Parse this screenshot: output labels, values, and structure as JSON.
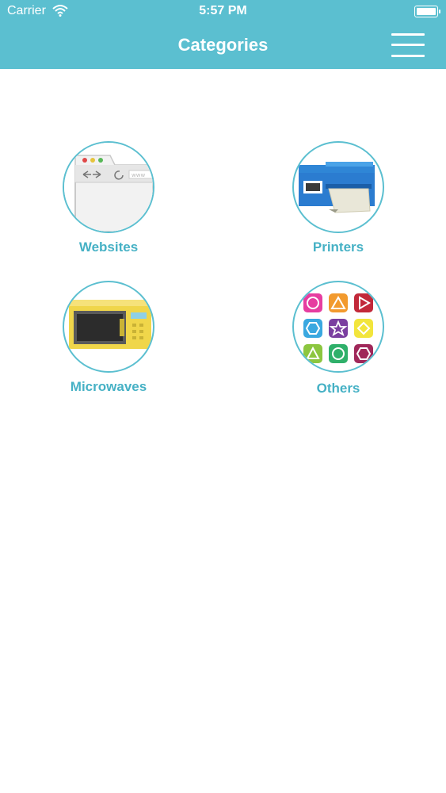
{
  "status_bar": {
    "carrier": "Carrier",
    "time": "5:57 PM"
  },
  "nav": {
    "title": "Categories"
  },
  "categories": [
    {
      "label": "Websites",
      "icon": "browser-window-icon"
    },
    {
      "label": "Printers",
      "icon": "printer-icon"
    },
    {
      "label": "Microwaves",
      "icon": "microwave-icon"
    },
    {
      "label": "Others",
      "icon": "shapes-grid-icon"
    }
  ],
  "colors": {
    "header": "#5bbfd0",
    "label": "#46b1c5",
    "background": "#ffffff"
  }
}
